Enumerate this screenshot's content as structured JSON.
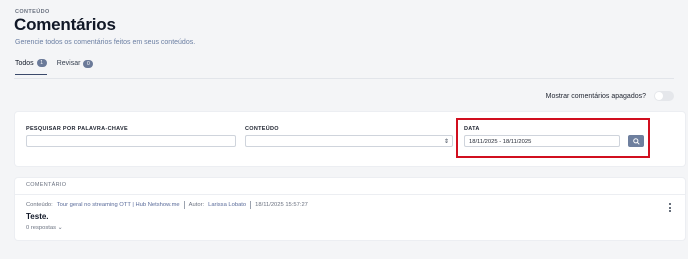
{
  "header": {
    "eyebrow": "CONTEÚDO",
    "title": "Comentários",
    "subtitle": "Gerencie todos os comentários feitos em seus conteúdos."
  },
  "tabs": [
    {
      "label": "Todos",
      "count": "1",
      "active": true
    },
    {
      "label": "Revisar",
      "count": "0",
      "active": false
    }
  ],
  "toggle": {
    "label": "Mostrar comentários apagados?",
    "on": false
  },
  "filters": {
    "keyword_label": "PESQUISAR POR PALAVRA-CHAVE",
    "keyword_value": "",
    "content_label": "CONTEÚDO",
    "content_value": "",
    "date_label": "DATA",
    "date_value": "18/11/2025 - 18/11/2025"
  },
  "comments": {
    "header": "COMENTÁRIO",
    "items": [
      {
        "content_prefix": "Conteúdo:",
        "content_title": "Tour geral no streaming OTT | Hub Netshow.me",
        "author_prefix": "Autor:",
        "author_name": "Larissa Lobato",
        "timestamp": "18/11/2025 15:57:27",
        "text": "Teste.",
        "replies": "0 respostas"
      }
    ]
  },
  "icons": {
    "search": "search-icon",
    "select": "select-arrows-icon",
    "more": "kebab-menu-icon",
    "replies": "chevron-down-icon"
  },
  "colors": {
    "highlight": "#d10f1f",
    "button": "#6e7f9e",
    "badge": "#6b7a99"
  }
}
